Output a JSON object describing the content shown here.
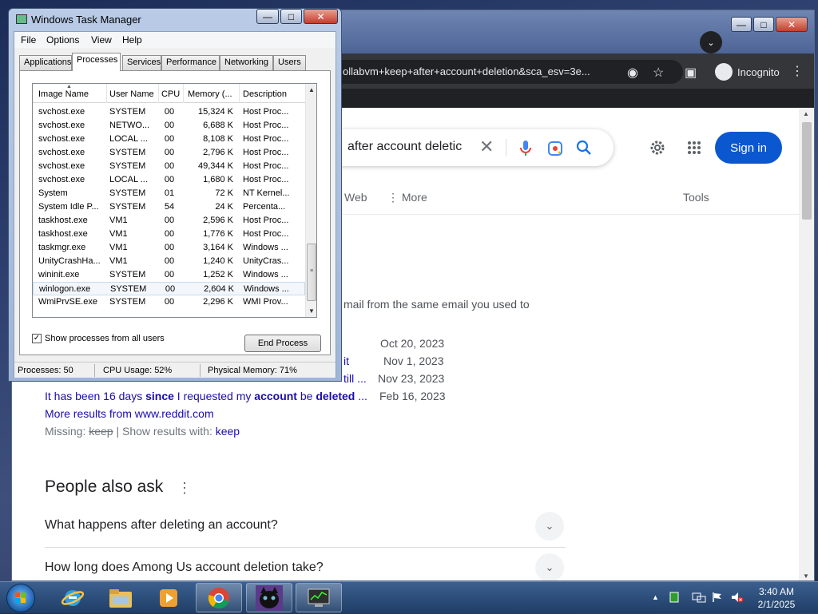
{
  "browser": {
    "omnibox_text": "ollabvm+keep+after+account+deletion&sca_esv=3e...",
    "profile_label": "Incognito"
  },
  "google": {
    "search_query": "after account deletic",
    "signin_label": "Sign in",
    "tab_web": "Web",
    "tab_more": "More",
    "tab_tools": "Tools",
    "snippet_text": "mail from the same email you used to",
    "result_tail_1": "it",
    "result_tail_2": "till ...",
    "results": [
      {
        "date": "Oct 20, 2023"
      },
      {
        "date": "Nov 1, 2023"
      },
      {
        "date": "Nov 23, 2023"
      },
      {
        "date": "Feb 16, 2023",
        "text_1": "It has been 16 days ",
        "bold_1": "since",
        "text_2": " I requested my ",
        "bold_2": "account",
        "text_3": " be ",
        "bold_3": "deleted",
        "text_4": " ..."
      }
    ],
    "more_results": "More results from www.reddit.com",
    "missing_label": "Missing: ",
    "missing_word": "keep",
    "show_results_label": " | Show results with: ",
    "show_results_word": "keep",
    "paa_heading": "People also ask",
    "paa_questions": [
      "What happens after deleting an account?",
      "How long does Among Us account deletion take?"
    ]
  },
  "task_manager": {
    "title": "Windows Task Manager",
    "menu": [
      "File",
      "Options",
      "View",
      "Help"
    ],
    "tabs": [
      "Applications",
      "Processes",
      "Services",
      "Performance",
      "Networking",
      "Users"
    ],
    "active_tab": "Processes",
    "columns": [
      "Image Name",
      "User Name",
      "CPU",
      "Memory (...",
      "Description"
    ],
    "rows": [
      {
        "name": "svchost.exe",
        "user": "SYSTEM",
        "cpu": "00",
        "mem": "15,324 K",
        "desc": "Host Proc..."
      },
      {
        "name": "svchost.exe",
        "user": "NETWO...",
        "cpu": "00",
        "mem": "6,688 K",
        "desc": "Host Proc..."
      },
      {
        "name": "svchost.exe",
        "user": "LOCAL ...",
        "cpu": "00",
        "mem": "8,108 K",
        "desc": "Host Proc..."
      },
      {
        "name": "svchost.exe",
        "user": "SYSTEM",
        "cpu": "00",
        "mem": "2,796 K",
        "desc": "Host Proc..."
      },
      {
        "name": "svchost.exe",
        "user": "SYSTEM",
        "cpu": "00",
        "mem": "49,344 K",
        "desc": "Host Proc..."
      },
      {
        "name": "svchost.exe",
        "user": "LOCAL ...",
        "cpu": "00",
        "mem": "1,680 K",
        "desc": "Host Proc..."
      },
      {
        "name": "System",
        "user": "SYSTEM",
        "cpu": "01",
        "mem": "72 K",
        "desc": "NT Kernel..."
      },
      {
        "name": "System Idle P...",
        "user": "SYSTEM",
        "cpu": "54",
        "mem": "24 K",
        "desc": "Percenta..."
      },
      {
        "name": "taskhost.exe",
        "user": "VM1",
        "cpu": "00",
        "mem": "2,596 K",
        "desc": "Host Proc..."
      },
      {
        "name": "taskhost.exe",
        "user": "VM1",
        "cpu": "00",
        "mem": "1,776 K",
        "desc": "Host Proc..."
      },
      {
        "name": "taskmgr.exe",
        "user": "VM1",
        "cpu": "00",
        "mem": "3,164 K",
        "desc": "Windows ..."
      },
      {
        "name": "UnityCrashHa...",
        "user": "VM1",
        "cpu": "00",
        "mem": "1,240 K",
        "desc": "UnityCras..."
      },
      {
        "name": "wininit.exe",
        "user": "SYSTEM",
        "cpu": "00",
        "mem": "1,252 K",
        "desc": "Windows ..."
      },
      {
        "name": "winlogon.exe",
        "user": "SYSTEM",
        "cpu": "00",
        "mem": "2,604 K",
        "desc": "Windows ..."
      },
      {
        "name": "WmiPrvSE.exe",
        "user": "SYSTEM",
        "cpu": "00",
        "mem": "2,296 K",
        "desc": "WMI Prov..."
      }
    ],
    "selected_row": 13,
    "show_all_label": "Show processes from all users",
    "show_all_checked": true,
    "end_process_label": "End Process",
    "status_processes": "Processes: 50",
    "status_cpu": "CPU Usage: 52%",
    "status_memory": "Physical Memory: 71%"
  },
  "taskbar": {
    "apps": [
      "start-orb",
      "internet-explorer-icon",
      "file-explorer-icon",
      "media-player-icon",
      "chrome-icon",
      "cat-app-icon",
      "task-manager-icon"
    ],
    "clock_time": "3:40 AM",
    "clock_date": "2/1/2025"
  }
}
